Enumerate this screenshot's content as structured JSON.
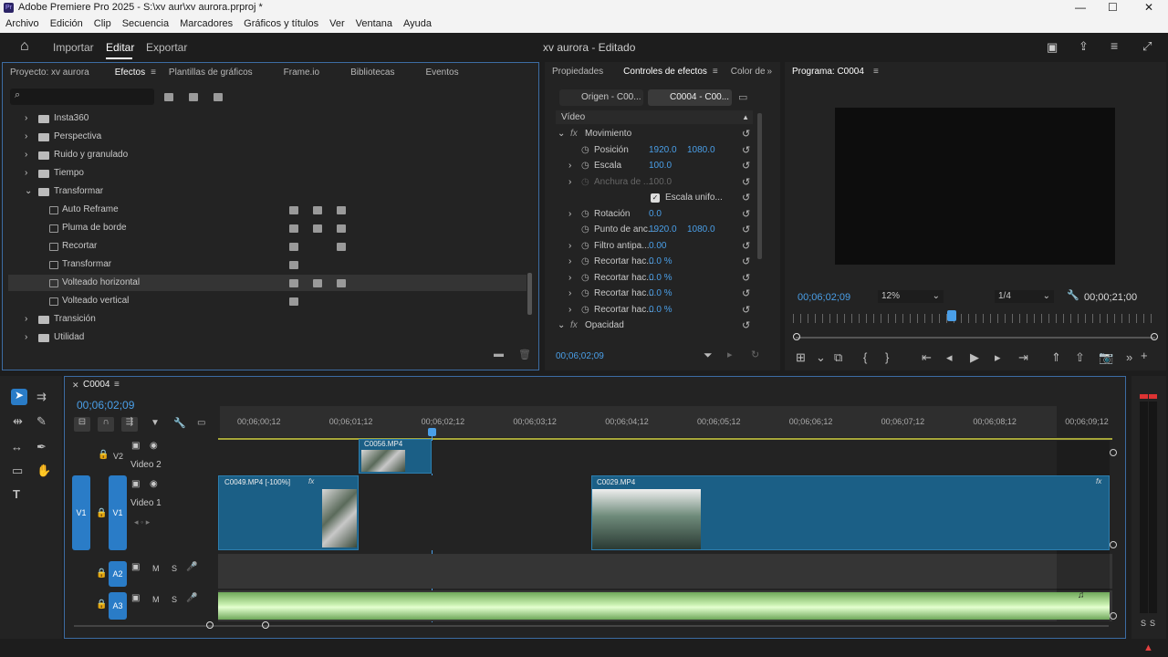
{
  "titlebar": {
    "app_title": "Adobe Premiere Pro 2025 - S:\\xv aur\\xv aurora.prproj *"
  },
  "menu": [
    "Archivo",
    "Edición",
    "Clip",
    "Secuencia",
    "Marcadores",
    "Gráficos y títulos",
    "Ver",
    "Ventana",
    "Ayuda"
  ],
  "header": {
    "tabs": [
      "Importar",
      "Editar",
      "Exportar"
    ],
    "active_tab": "Editar",
    "project_state": "xv aurora - Editado"
  },
  "project_panel": {
    "tabs": [
      "Proyecto: xv aurora",
      "Efectos",
      "Plantillas de gráficos",
      "Frame.io",
      "Bibliotecas",
      "Eventos"
    ],
    "active_tab": "Efectos",
    "search_placeholder": "",
    "items": [
      {
        "label": "Insta360",
        "type": "folder",
        "level": 0
      },
      {
        "label": "Perspectiva",
        "type": "folder",
        "level": 0
      },
      {
        "label": "Ruido y granulado",
        "type": "folder",
        "level": 0
      },
      {
        "label": "Tiempo",
        "type": "folder",
        "level": 0
      },
      {
        "label": "Transformar",
        "type": "folder",
        "level": 0,
        "expanded": true
      },
      {
        "label": "Auto Reframe",
        "type": "effect",
        "level": 1
      },
      {
        "label": "Pluma de borde",
        "type": "effect",
        "level": 1
      },
      {
        "label": "Recortar",
        "type": "effect",
        "level": 1
      },
      {
        "label": "Transformar",
        "type": "effect",
        "level": 1
      },
      {
        "label": "Volteado horizontal",
        "type": "effect",
        "level": 1,
        "selected": true
      },
      {
        "label": "Volteado vertical",
        "type": "effect",
        "level": 1
      },
      {
        "label": "Transición",
        "type": "folder",
        "level": 0
      },
      {
        "label": "Utilidad",
        "type": "folder",
        "level": 0
      }
    ]
  },
  "effect_controls": {
    "tabs": [
      "Propiedades",
      "Controles de efectos",
      "Color de"
    ],
    "active_tab": "Controles de efectos",
    "source_tab": "Origen - C00...",
    "seq_tab": "C0004 - C00...",
    "section": "Vídeo",
    "rows": [
      {
        "label": "Movimiento",
        "kind": "group"
      },
      {
        "label": "Posición",
        "v1": "1920.0",
        "v2": "1080.0"
      },
      {
        "label": "Escala",
        "v1": "100.0"
      },
      {
        "label": "Anchura de ...",
        "v1": "100.0",
        "disabled": true
      },
      {
        "label": "Escala unifo...",
        "checkbox": true
      },
      {
        "label": "Rotación",
        "v1": "0.0"
      },
      {
        "label": "Punto de anc...",
        "v1": "1920.0",
        "v2": "1080.0"
      },
      {
        "label": "Filtro antipa...",
        "v1": "0.00"
      },
      {
        "label": "Recortar hac...",
        "v1": "0.0 %"
      },
      {
        "label": "Recortar hac...",
        "v1": "0.0 %"
      },
      {
        "label": "Recortar hac...",
        "v1": "0.0 %"
      },
      {
        "label": "Recortar hac...",
        "v1": "0.0 %"
      },
      {
        "label": "Opacidad",
        "kind": "group"
      }
    ],
    "timecode": "00;06;02;09"
  },
  "program": {
    "title": "Programa: C0004",
    "timecode": "00;06;02;09",
    "zoom": "12%",
    "resolution": "1/4",
    "duration": "00;00;21;00"
  },
  "timeline": {
    "sequence": "C0004",
    "timecode": "00;06;02;09",
    "ruler": [
      "00;06;00;12",
      "00;06;01;12",
      "00;06;02;12",
      "00;06;03;12",
      "00;06;04;12",
      "00;06;05;12",
      "00;06;06;12",
      "00;06;07;12",
      "00;06;08;12",
      "00;06;09;12"
    ],
    "tracks": [
      {
        "id": "V2",
        "name": "Video 2"
      },
      {
        "id": "V1",
        "name": "Video 1"
      },
      {
        "id": "A2"
      },
      {
        "id": "A3"
      }
    ],
    "clips": [
      {
        "name": "C0056.MP4",
        "track": "V2"
      },
      {
        "name": "C0049.MP4 [-100%]",
        "track": "V1"
      },
      {
        "name": "C0029.MP4",
        "track": "V1"
      }
    ],
    "track_letters": {
      "mute": "M",
      "solo": "S"
    }
  },
  "colors": {
    "accent": "#2a7cc7",
    "clip": "#1b5f86",
    "audio": "#8fd27a",
    "timecode": "#4a9fe8"
  }
}
